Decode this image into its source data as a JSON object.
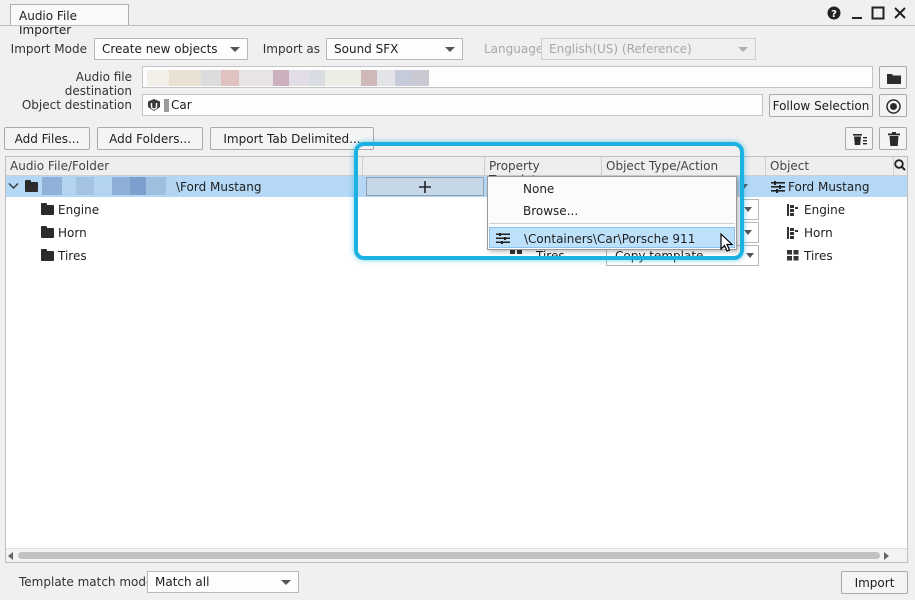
{
  "window": {
    "tab_title": "Audio File Importer",
    "icons": [
      "help-icon",
      "minimize-icon",
      "maximize-icon",
      "close-icon"
    ]
  },
  "form": {
    "import_mode_label": "Import Mode",
    "import_mode_value": "Create new objects",
    "import_as_label": "Import as",
    "import_as_value": "Sound SFX",
    "language_label": "Language",
    "language_value": "English(US) (Reference)",
    "audio_dest_label": "Audio file destination",
    "object_dest_label": "Object destination",
    "object_dest_value": "Car",
    "follow_selection": "Follow Selection"
  },
  "toolbar": {
    "add_files": "Add Files...",
    "add_folders": "Add Folders...",
    "import_tab": "Import Tab Delimited..."
  },
  "table": {
    "headers": {
      "audio": "Audio File/Folder",
      "property_template": "Property Template",
      "object_type": "Object Type/Action",
      "object": "Object"
    },
    "root": {
      "name": "\\Ford Mustang",
      "object": "Ford Mustang"
    },
    "children": [
      {
        "name": "Engine",
        "object": "Engine"
      },
      {
        "name": "Horn",
        "object": "Horn"
      },
      {
        "name": "Tires",
        "object": "Tires",
        "template": "Tires",
        "action": "Copy template"
      }
    ]
  },
  "dropdown": {
    "items": [
      "None",
      "Browse...",
      "\\Containers\\Car\\Porsche  911"
    ]
  },
  "footer": {
    "template_match_label": "Template match mode",
    "template_match_value": "Match all",
    "import_button": "Import"
  },
  "colors": {
    "selection": "#b5d8f6",
    "highlight_outline": "#1bb2e2"
  }
}
